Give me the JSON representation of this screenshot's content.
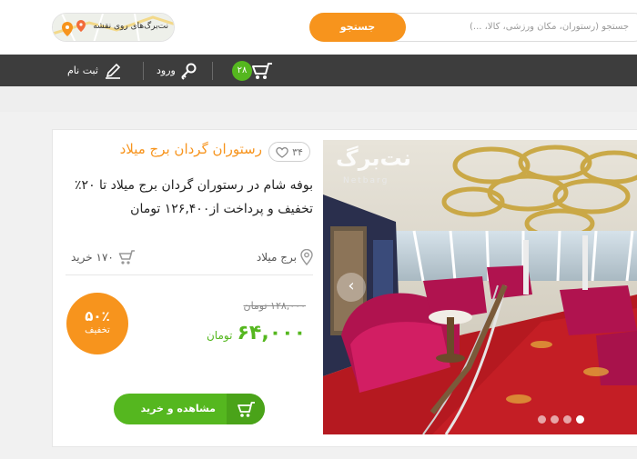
{
  "header": {
    "search_placeholder": "جستجو (رستوران، مکان ورزشی، کالا، ...)",
    "search_button": "جستجو",
    "map_link": "نت‌برگ‌های روی نقشه"
  },
  "navbar": {
    "cart_count": "۲۸",
    "login": "ورود",
    "register": "ثبت نام"
  },
  "card": {
    "favorites_count": "۳۴",
    "title": "رستوران گردان برج میلاد",
    "description": "بوفه شام در رستوران گردان برج میلاد تا ۲۰٪ تخفیف و پرداخت از۱۲۶,۴۰۰ تومان",
    "location": "برج میلاد",
    "purchases": "۱۷۰ خرید",
    "discount_percent": "۵۰٪",
    "discount_word": "تخفیف",
    "old_price": "۱۲۸,۰۰۰ تومان",
    "new_price": "۶۴,۰۰۰",
    "new_price_unit": "تومان",
    "buy_button": "مشاهده و خرید"
  },
  "photo": {
    "watermark": "نت‌برگ",
    "watermark_sub": "Netbarg",
    "slide_count": 4,
    "active_slide": 4
  },
  "colors": {
    "accent_orange": "#f7941d",
    "accent_green": "#55b71f",
    "navbar_dark": "#3d3d3d"
  }
}
